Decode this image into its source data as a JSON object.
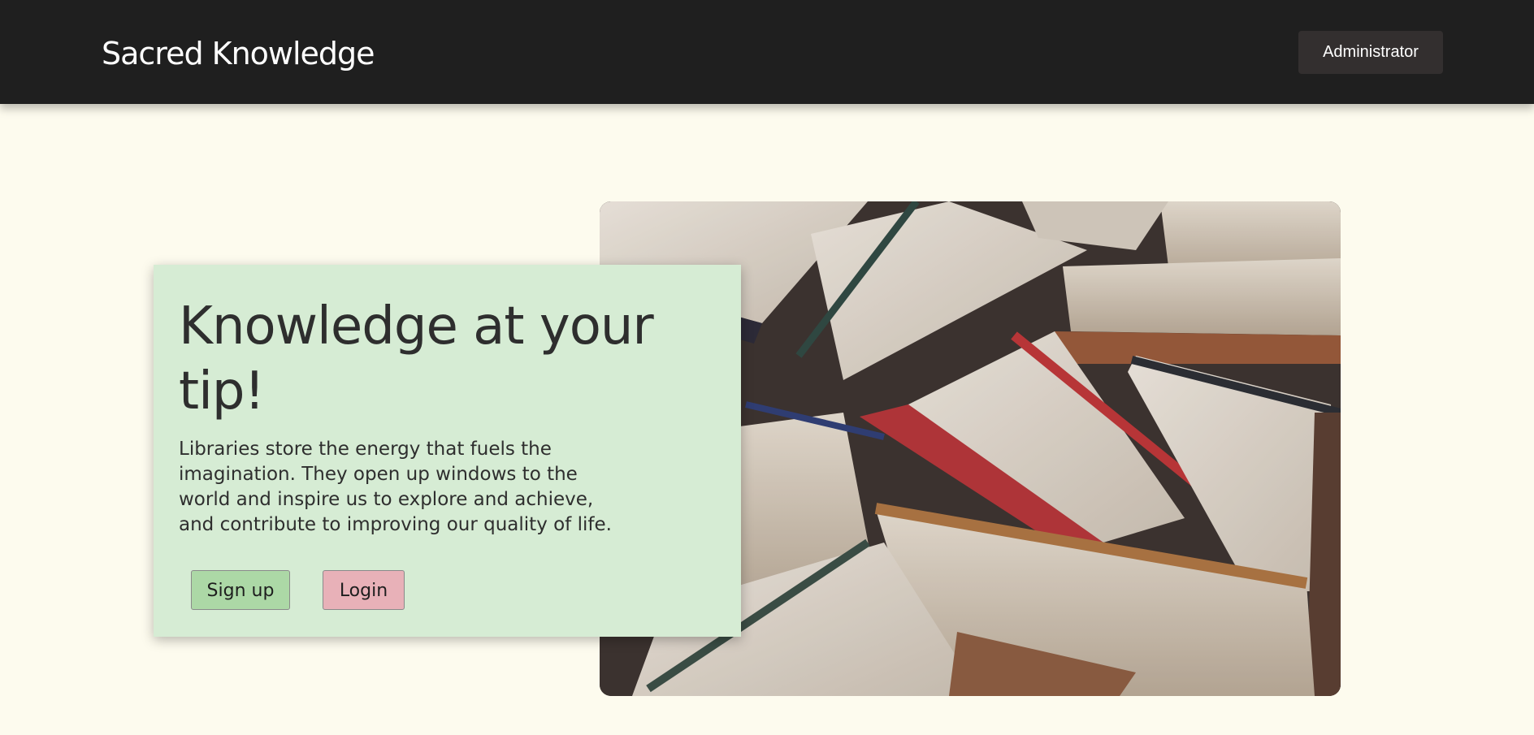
{
  "header": {
    "brand": "Sacred Knowledge",
    "admin_label": "Administrator"
  },
  "hero": {
    "title": "Knowledge at your tip!",
    "description": "Libraries store the energy that fuels the imagination. They open up windows to the world and inspire us to explore and achieve, and contribute to improving our quality of life.",
    "signup_label": "Sign up",
    "login_label": "Login"
  },
  "colors": {
    "navbar": "#1f1f1f",
    "page_background": "#fdfbee",
    "card_background": "#d6ecd4",
    "signup_button": "#acd8a6",
    "login_button": "#e8b1b8"
  }
}
